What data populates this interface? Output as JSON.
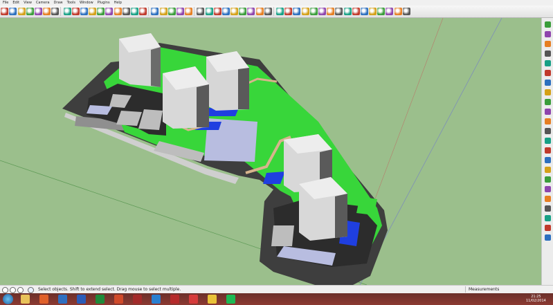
{
  "menu": [
    "File",
    "Edit",
    "View",
    "Camera",
    "Draw",
    "Tools",
    "Window",
    "Plugins",
    "Help"
  ],
  "toolbar_icons": [
    "select",
    "eraser",
    "paint-bucket",
    "component",
    "line",
    "arc",
    "rectangle",
    "circle",
    "polygon",
    "freehand",
    "push-pull",
    "move",
    "rotate",
    "follow-me",
    "scale",
    "offset",
    "tape-measure",
    "dimension",
    "protractor",
    "text",
    "axes",
    "3d-text",
    "orbit",
    "pan",
    "zoom",
    "zoom-window",
    "zoom-extents",
    "previous",
    "position-camera",
    "walk",
    "look-around",
    "section-plane",
    "x-ray",
    "wireframe",
    "hidden-line",
    "shaded",
    "shaded-textures",
    "monochrome",
    "iso",
    "top",
    "front",
    "right",
    "back",
    "left",
    "sandbox",
    "warehouse",
    "extension"
  ],
  "right_toolbar_icons": [
    "blank",
    "plugin-1",
    "plugin-2",
    "plugin-3",
    "plugin-4",
    "plugin-5",
    "plugin-6",
    "plugin-7",
    "plugin-8",
    "plugin-9",
    "plugin-10",
    "plugin-11",
    "plugin-12",
    "plugin-13",
    "plugin-14",
    "plugin-15",
    "plugin-16",
    "plugin-17",
    "plugin-18",
    "plugin-19",
    "plugin-20",
    "plugin-21",
    "plugin-22"
  ],
  "status": {
    "message": "Select objects. Shift to extend select. Drag mouse to select multiple.",
    "measurements_label": "Measurements"
  },
  "taskbar": {
    "apps": [
      "explorer",
      "firefox",
      "outlook",
      "word",
      "excel",
      "powerpoint",
      "access",
      "paint",
      "filezilla",
      "sketchup",
      "chrome",
      "spotify"
    ],
    "time": "21:25",
    "date": "11/02/2014"
  },
  "colors": {
    "ground": "#9bbf8c",
    "grass": "#38d63a",
    "road": "#3e3e3e",
    "water": "#1f3fe0",
    "building": "#e3e3e3",
    "paving": "#b8bde0",
    "path": "#d7b48c"
  }
}
